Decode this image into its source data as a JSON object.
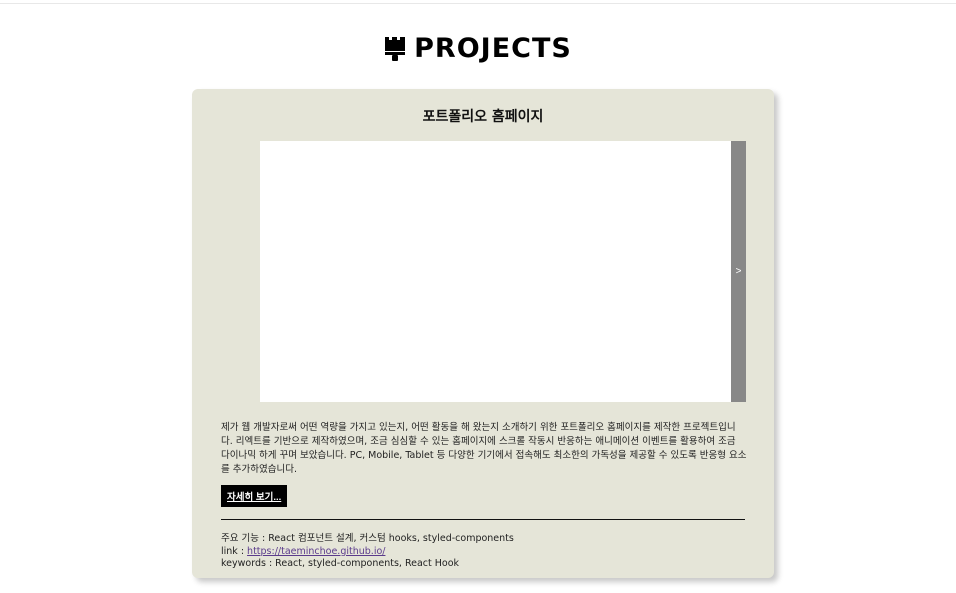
{
  "section": {
    "icon": "brush-icon",
    "title": "PROJECTS"
  },
  "project": {
    "title": "포트폴리오 홈페이지",
    "carousel": {
      "next_label": ">"
    },
    "description": "제가 웹 개발자로써 어떤 역량을 가지고 있는지, 어떤 활동을 해 왔는지 소개하기 위한 포트폴리오 홈페이지를 제작한 프로젝트입니다. 리엑트를 기반으로 제작하였으며, 조금 심심할 수 있는 홈페이지에 스크롤 작동시 반응하는 애니메이션 이벤트를 활용하여 조금 다이나믹 하게 꾸며 보았습니다. PC, Mobile, Tablet 등 다양한 기기에서 접속해도 최소한의 가독성을 제공할 수 있도록 반응형 요소를 추가하였습니다.",
    "more_label": "자세히 보기...",
    "features_label": "주요 기능 : ",
    "features_value": "React 컴포넌트 설계, 커스텀 hooks, styled-components",
    "link_label": "link : ",
    "link_value": "https://taeminchoe.github.io/",
    "keywords_label": "keywords : ",
    "keywords_value": "React, styled-components, React Hook"
  },
  "colors": {
    "card_background": "#e5e5d8",
    "next_button": "#888888",
    "more_button": "#000000",
    "link": "#5b3b8c"
  }
}
